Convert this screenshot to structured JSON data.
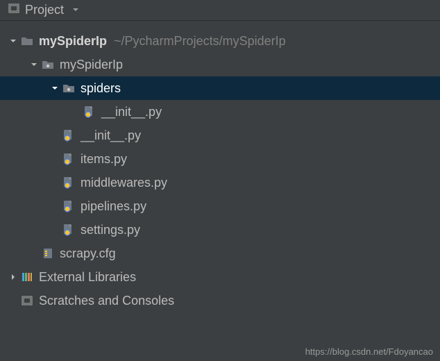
{
  "toolbar": {
    "title": "Project"
  },
  "tree": {
    "root": {
      "label": "mySpiderIp",
      "path": "~/PycharmProjects/mySpiderIp"
    },
    "pkg": {
      "label": "mySpiderIp"
    },
    "spiders": {
      "label": "spiders"
    },
    "files": {
      "spiders_init": "__init__.py",
      "init": "__init__.py",
      "items": "items.py",
      "middlewares": "middlewares.py",
      "pipelines": "pipelines.py",
      "settings": "settings.py",
      "scrapycfg": "scrapy.cfg"
    },
    "external": "External Libraries",
    "scratches": "Scratches and Consoles"
  },
  "watermark": "https://blog.csdn.net/Fdoyancao"
}
